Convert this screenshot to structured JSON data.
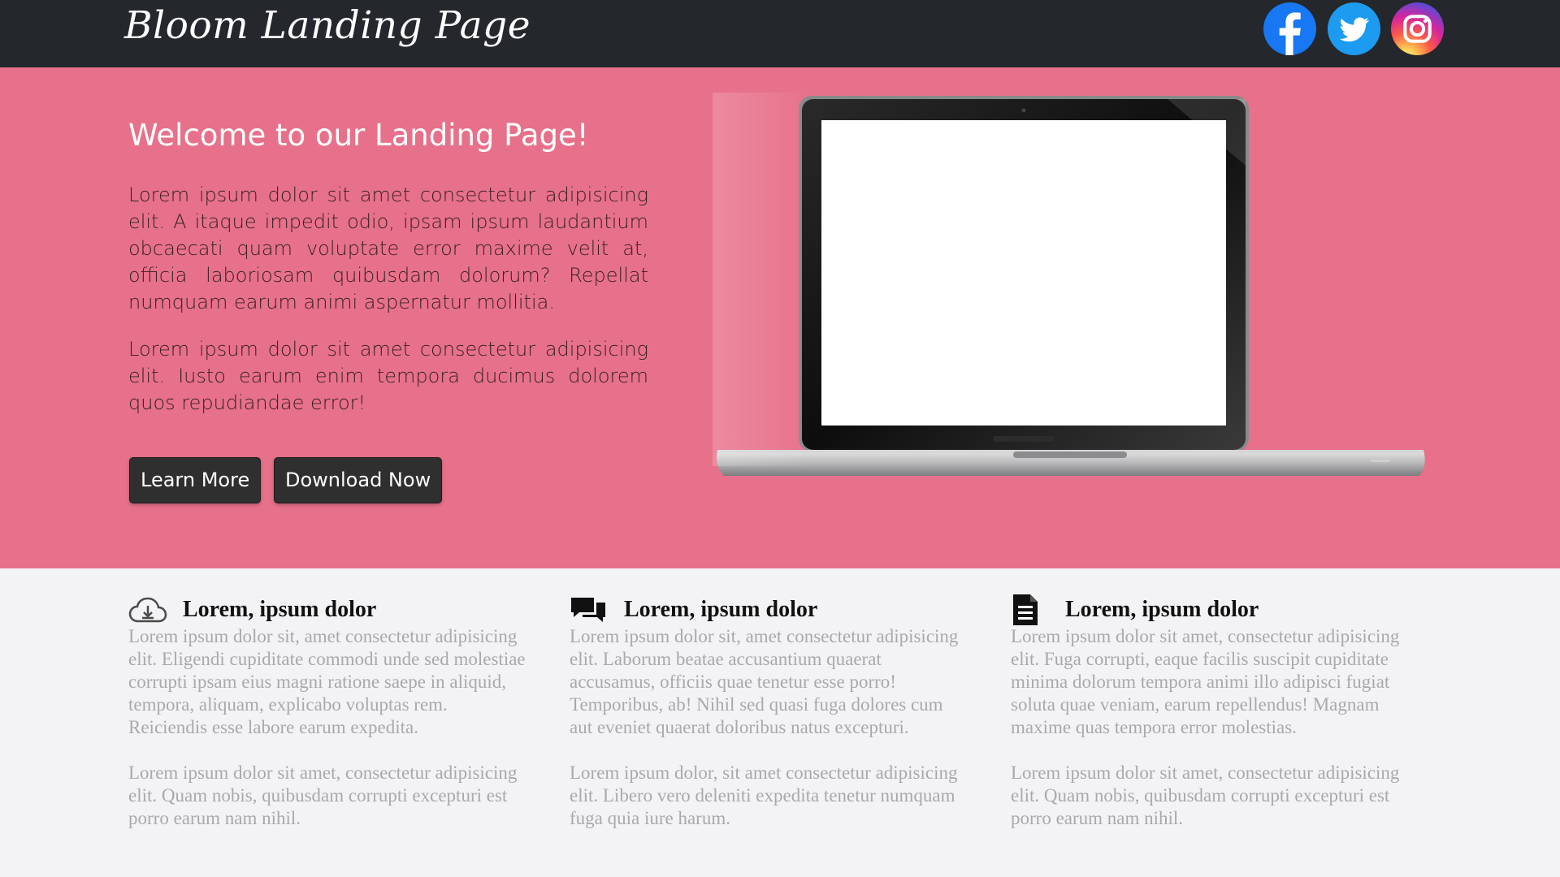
{
  "navbar": {
    "brand": "Bloom Landing Page",
    "social": [
      {
        "name": "facebook-icon",
        "color": "#1877f2"
      },
      {
        "name": "twitter-icon",
        "color": "#1d9bf0"
      },
      {
        "name": "instagram-icon",
        "color": "#d6249f"
      }
    ]
  },
  "hero": {
    "title": "Welcome to our Landing Page!",
    "paragraph1": "Lorem ipsum dolor sit amet consectetur adipisicing elit. A itaque impedit odio, ipsam ipsum laudantium obcaecati quam voluptate error maxime velit at, officia laboriosam quibusdam dolorum? Repellat numquam earum animi aspernatur mollitia.",
    "paragraph2": "Lorem ipsum dolor sit amet consectetur adipisicing elit. Iusto earum enim tempora ducimus dolorem quos repudiandae error!",
    "learn_more_label": "Learn More",
    "download_label": "Download Now",
    "background_color": "#e7718a",
    "image": "laptop-image"
  },
  "features": [
    {
      "icon": "cloud-download-icon",
      "title": "Lorem, ipsum dolor",
      "p1": "Lorem ipsum dolor sit, amet consectetur adipisicing elit. Eligendi cupiditate commodi unde sed molestiae corrupti ipsam eius magni ratione saepe in aliquid, tempora, aliquam, explicabo voluptas rem. Reiciendis esse labore earum expedita.",
      "p2": "Lorem ipsum dolor sit amet, consectetur adipisicing elit. Quam nobis, quibusdam corrupti excepturi est porro earum nam nihil."
    },
    {
      "icon": "comments-icon",
      "title": "Lorem, ipsum dolor",
      "p1": "Lorem ipsum dolor sit, amet consectetur adipisicing elit. Laborum beatae accusantium quaerat accusamus, officiis quae tenetur esse porro! Temporibus, ab! Nihil sed quasi fuga dolores cum aut eveniet quaerat doloribus natus excepturi.",
      "p2": "Lorem ipsum dolor, sit amet consectetur adipisicing elit. Libero vero deleniti expedita tenetur numquam fuga quia iure harum."
    },
    {
      "icon": "document-icon",
      "title": "Lorem, ipsum dolor",
      "p1": "Lorem ipsum dolor sit amet, consectetur adipisicing elit. Fuga corrupti, eaque facilis suscipit cupiditate minima dolorum tempora animi illo adipisci fugiat soluta quae veniam, earum repellendus! Magnam maxime quas tempora error molestias.",
      "p2": "Lorem ipsum dolor sit amet, consectetur adipisicing elit. Quam nobis, quibusdam corrupti excepturi est porro earum nam nihil."
    }
  ]
}
